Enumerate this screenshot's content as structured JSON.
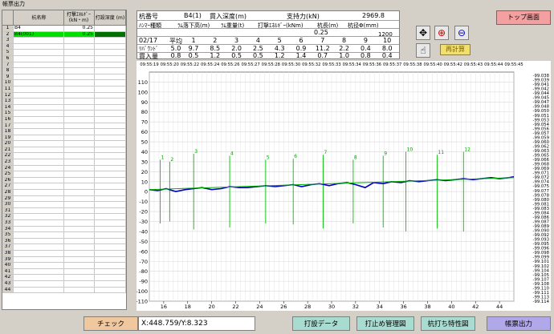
{
  "window": {
    "title": "帳票出力"
  },
  "left_table": {
    "headers": [
      "",
      "杭名称",
      "打撃ｴﾈﾙｷﾞｰ\n(kN・m)",
      "打設深度\n(m)"
    ],
    "rows": [
      {
        "no": "1",
        "name": "B4",
        "energy": "0.25",
        "depth": ""
      },
      {
        "no": "2",
        "name": "B4(001)",
        "energy": "0.25",
        "depth": "",
        "selected": true
      },
      {
        "no": "3",
        "name": "",
        "energy": "",
        "depth": ""
      },
      {
        "no": "4",
        "name": "",
        "energy": "",
        "depth": ""
      },
      {
        "no": "5",
        "name": "",
        "energy": "",
        "depth": ""
      },
      {
        "no": "6",
        "name": "",
        "energy": "",
        "depth": ""
      },
      {
        "no": "7",
        "name": "",
        "energy": "",
        "depth": ""
      },
      {
        "no": "8",
        "name": "",
        "energy": "",
        "depth": ""
      },
      {
        "no": "9",
        "name": "",
        "energy": "",
        "depth": ""
      },
      {
        "no": "10",
        "name": "",
        "energy": "",
        "depth": ""
      },
      {
        "no": "11",
        "name": "",
        "energy": "",
        "depth": ""
      },
      {
        "no": "12",
        "name": "",
        "energy": "",
        "depth": ""
      },
      {
        "no": "13",
        "name": "",
        "energy": "",
        "depth": ""
      },
      {
        "no": "14",
        "name": "",
        "energy": "",
        "depth": ""
      },
      {
        "no": "15",
        "name": "",
        "energy": "",
        "depth": ""
      },
      {
        "no": "16",
        "name": "",
        "energy": "",
        "depth": ""
      },
      {
        "no": "17",
        "name": "",
        "energy": "",
        "depth": ""
      },
      {
        "no": "18",
        "name": "",
        "energy": "",
        "depth": ""
      },
      {
        "no": "19",
        "name": "",
        "energy": "",
        "depth": ""
      },
      {
        "no": "20",
        "name": "",
        "energy": "",
        "depth": ""
      },
      {
        "no": "21",
        "name": "",
        "energy": "",
        "depth": ""
      },
      {
        "no": "22",
        "name": "",
        "energy": "",
        "depth": ""
      },
      {
        "no": "23",
        "name": "",
        "energy": "",
        "depth": ""
      },
      {
        "no": "24",
        "name": "",
        "energy": "",
        "depth": ""
      },
      {
        "no": "25",
        "name": "",
        "energy": "",
        "depth": ""
      },
      {
        "no": "26",
        "name": "",
        "energy": "",
        "depth": ""
      },
      {
        "no": "27",
        "name": "",
        "energy": "",
        "depth": ""
      },
      {
        "no": "28",
        "name": "",
        "energy": "",
        "depth": ""
      },
      {
        "no": "29",
        "name": "",
        "energy": "",
        "depth": ""
      },
      {
        "no": "30",
        "name": "",
        "energy": "",
        "depth": ""
      },
      {
        "no": "31",
        "name": "",
        "energy": "",
        "depth": ""
      },
      {
        "no": "32",
        "name": "",
        "energy": "",
        "depth": ""
      },
      {
        "no": "33",
        "name": "",
        "energy": "",
        "depth": ""
      },
      {
        "no": "34",
        "name": "",
        "energy": "",
        "depth": ""
      },
      {
        "no": "35",
        "name": "",
        "energy": "",
        "depth": ""
      },
      {
        "no": "36",
        "name": "",
        "energy": "",
        "depth": ""
      },
      {
        "no": "37",
        "name": "",
        "energy": "",
        "depth": ""
      },
      {
        "no": "38",
        "name": "",
        "energy": "",
        "depth": ""
      },
      {
        "no": "39",
        "name": "",
        "energy": "",
        "depth": ""
      },
      {
        "no": "40",
        "name": "",
        "energy": "",
        "depth": ""
      },
      {
        "no": "41",
        "name": "",
        "energy": "",
        "depth": ""
      },
      {
        "no": "42",
        "name": "",
        "energy": "",
        "depth": ""
      },
      {
        "no": "43",
        "name": "",
        "energy": "",
        "depth": ""
      },
      {
        "no": "44",
        "name": "",
        "energy": "",
        "depth": ""
      }
    ]
  },
  "info": {
    "pile_no_label": "杭番号",
    "pile_no": "B4(1)",
    "penetration_label": "貫入深度(m)",
    "bearing_label": "支持力(kN)",
    "bearing": "2969.8",
    "hammer_label": "ﾊﾝﾏｰ種類",
    "drop_label": "ﾗﾑ落下高(m)",
    "ram_weight_label": "ﾗﾑ重量(t)",
    "energy_label": "打撃ｴﾈﾙｷﾞｰ(kNm)",
    "pile_length_label": "杭長(m)",
    "pile_dia_label": "杭径Φ(mm)",
    "energy": "0.25",
    "pile_dia": "1200",
    "date": "02/17",
    "avg_label": "平均",
    "cols": [
      "1",
      "2",
      "3",
      "4",
      "5",
      "6",
      "7",
      "8",
      "9",
      "10"
    ],
    "rebound_label": "ﾘﾊﾞｳﾝﾄﾞ",
    "rebound_avg": "5.0",
    "rebound": [
      "9.7",
      "8.5",
      "2.0",
      "2.5",
      "4.3",
      "0.9",
      "11.2",
      "2.2",
      "0.4",
      "8.0"
    ],
    "penet_label": "貫入量",
    "penet_avg": "0.8",
    "penet": [
      "0.5",
      "1.2",
      "0.5",
      "0.5",
      "1.2",
      "1.4",
      "0.7",
      "1.0",
      "0.8",
      "0.4"
    ]
  },
  "buttons": {
    "top": "トップ画面",
    "recalc": "再計算",
    "check": "チェック",
    "drive_data": "打設データ",
    "stop_chart": "打止め管理図",
    "pile_char": "杭打ち特性図",
    "report": "帳票出力"
  },
  "icons": [
    "move-icon",
    "zoom-in-icon",
    "zoom-out-icon",
    "hand-icon"
  ],
  "coord_readout": "X:448.759/Y:8.323",
  "colors": {
    "trace": "#0000c0",
    "trend": "#00b000",
    "markers": "#00c000"
  },
  "chart_data": {
    "type": "line",
    "title": "",
    "xlabel": "",
    "ylabel": "",
    "xlim": [
      14.8,
      45.2
    ],
    "ylim": [
      -110,
      120
    ],
    "y_ticks": [
      110,
      100,
      90,
      80,
      70,
      60,
      50,
      40,
      30,
      20,
      10,
      0,
      -10,
      -20,
      -30,
      -40,
      -50,
      -60,
      -70,
      -80,
      -90,
      -100,
      -110
    ],
    "x_ticks": [
      16,
      18,
      20,
      22,
      24,
      26,
      28,
      30,
      32,
      34,
      36,
      38,
      40,
      42,
      44
    ],
    "time_ticks": [
      "09:55:19",
      "09:55:20",
      "09:55:22",
      "09:55:24",
      "09:55:26",
      "09:55:27",
      "09:55:28",
      "09:55:30",
      "09:55:32",
      "09:55:33",
      "09:55:34",
      "09:55:36",
      "09:55:37",
      "09:55:38",
      "09:55:40",
      "09:55:42",
      "09:55:43",
      "09:55:44",
      "09:55:45"
    ],
    "right_axis_labels": [
      "-99.038",
      "-99.039",
      "-99.041",
      "-99.042",
      "-99.044",
      "-99.045",
      "-99.047",
      "-99.048",
      "-99.050",
      "-99.051",
      "-99.053",
      "-99.054",
      "-99.056",
      "-99.057",
      "-99.059",
      "-99.060",
      "-99.062",
      "-99.063",
      "-99.065",
      "-99.066",
      "-99.068",
      "-99.069",
      "-99.071",
      "-99.072",
      "-99.074",
      "-99.075",
      "-99.077",
      "-99.078",
      "-99.080",
      "-99.081",
      "-99.083",
      "-99.084",
      "-99.086",
      "-99.087",
      "-99.089",
      "-99.090",
      "-99.092",
      "-99.093",
      "-99.095",
      "-99.096",
      "-99.098",
      "-99.099",
      "-99.101",
      "-99.102",
      "-99.104",
      "-99.105",
      "-99.107",
      "-99.108",
      "-99.110",
      "-99.111",
      "-99.113",
      "-99.114"
    ],
    "blow_markers": [
      {
        "n": "1",
        "x": 15.7,
        "top": 32
      },
      {
        "n": "2",
        "x": 16.5,
        "top": 30
      },
      {
        "n": "3",
        "x": 18.5,
        "top": 38
      },
      {
        "n": "4",
        "x": 21.5,
        "top": 36
      },
      {
        "n": "5",
        "x": 24.5,
        "top": 32
      },
      {
        "n": "6",
        "x": 26.8,
        "top": 33
      },
      {
        "n": "7",
        "x": 29.3,
        "top": 37
      },
      {
        "n": "8",
        "x": 31.8,
        "top": 32
      },
      {
        "n": "9",
        "x": 34.3,
        "top": 36
      },
      {
        "n": "10",
        "x": 36.2,
        "top": 40
      },
      {
        "n": "11",
        "x": 38.8,
        "top": 37
      },
      {
        "n": "12",
        "x": 41.0,
        "top": 40
      }
    ],
    "series": [
      {
        "name": "",
        "style": "trace",
        "x": [
          14.8,
          15.5,
          16.2,
          17.0,
          17.8,
          18.5,
          19.2,
          20.0,
          20.8,
          21.5,
          22.3,
          23.0,
          23.8,
          24.5,
          25.3,
          26.0,
          26.8,
          27.5,
          28.3,
          29.0,
          29.8,
          30.5,
          31.3,
          32.0,
          32.8,
          33.5,
          34.3,
          35.0,
          35.8,
          36.5,
          37.3,
          38.0,
          38.8,
          39.5,
          40.3,
          41.0,
          41.8,
          42.5,
          43.3,
          44.0,
          44.8,
          45.2
        ],
        "y": [
          2,
          1,
          3,
          0,
          2,
          3,
          4,
          2,
          3,
          5,
          4,
          4,
          5,
          6,
          5,
          6,
          7,
          5,
          7,
          8,
          6,
          8,
          9,
          7,
          4,
          9,
          8,
          10,
          9,
          11,
          10,
          11,
          12,
          11,
          12,
          13,
          12,
          13,
          14,
          13,
          14,
          15
        ]
      },
      {
        "name": "",
        "style": "trend",
        "x": [
          14.8,
          45.2
        ],
        "y": [
          2,
          14
        ]
      }
    ]
  }
}
